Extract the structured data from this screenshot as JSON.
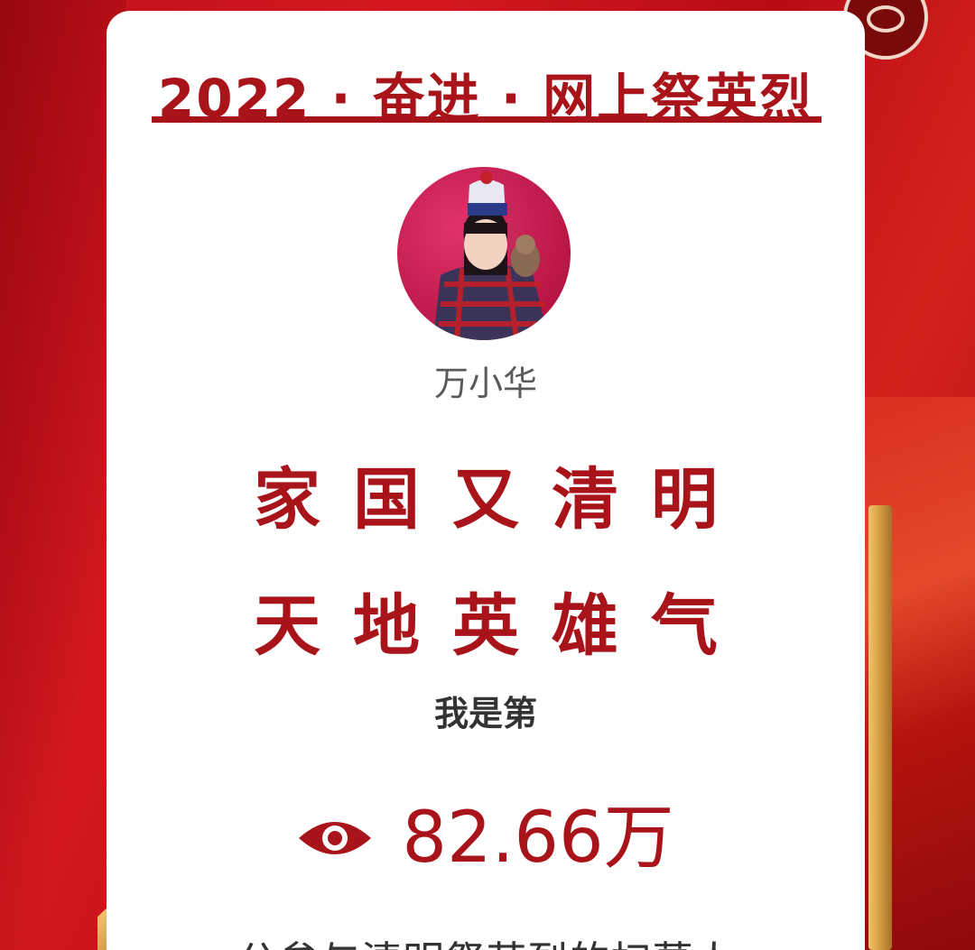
{
  "header": {
    "title": "2022 · 奋进 · 网上祭英烈"
  },
  "profile": {
    "name": "万小华"
  },
  "poem": {
    "line1": "家国又清明",
    "line2": "天地英雄气"
  },
  "rank": {
    "text": "我是第"
  },
  "stats": {
    "views": "82.66万",
    "icon": "eye-icon"
  },
  "footer": {
    "text": "公参与清明祭英烈的扫墓人"
  },
  "colors": {
    "accent": "#a8141a",
    "background": "#c8141c"
  }
}
